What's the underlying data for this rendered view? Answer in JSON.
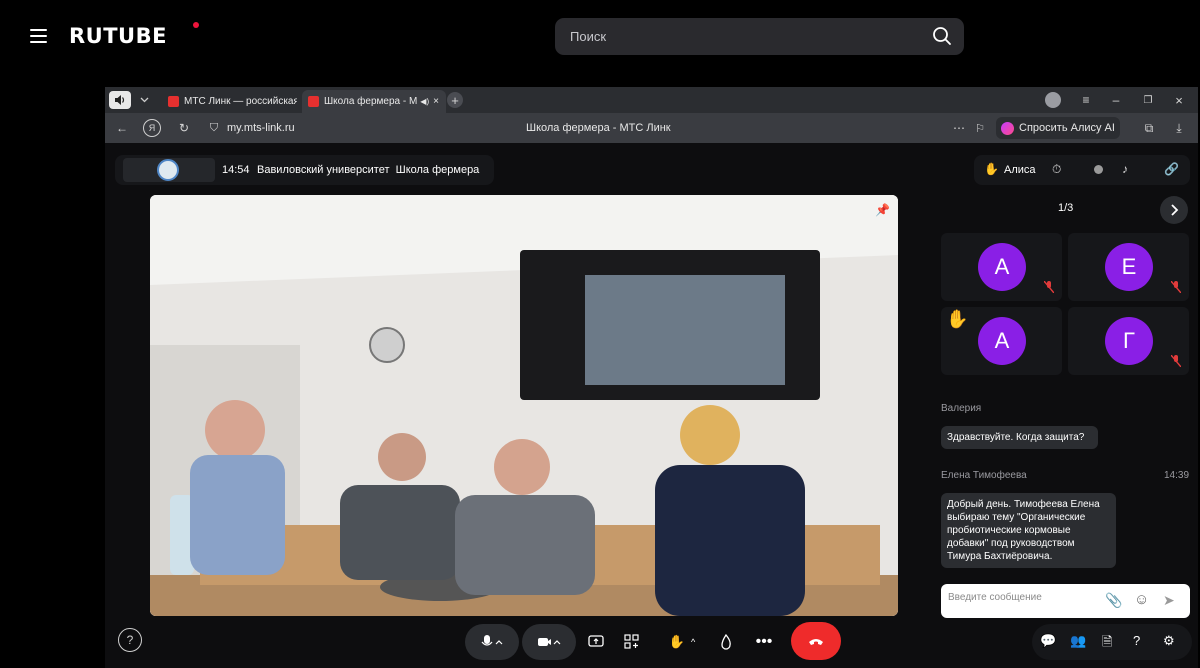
{
  "rutube": {
    "logo": "RUTUBE",
    "search_placeholder": "Поиск"
  },
  "browser": {
    "tabs": [
      {
        "label": "МТС Линк — российская"
      },
      {
        "label": "Школа фермера - М"
      }
    ],
    "address": "my.mts-link.ru",
    "page_title": "Школа фермера - МТС Линк",
    "alice_button": "Спросить Алису AI"
  },
  "meeting": {
    "time": "14:54",
    "title": "Вавиловский университет  Школа фермера",
    "alice_label": "Алиса",
    "page_indicator": "1/3",
    "participants": [
      {
        "initial": "А",
        "mic_muted": true,
        "hand_raised": false
      },
      {
        "initial": "Е",
        "mic_muted": true,
        "hand_raised": false
      },
      {
        "initial": "А",
        "mic_muted": false,
        "hand_raised": true
      },
      {
        "initial": "Г",
        "mic_muted": true,
        "hand_raised": false
      }
    ],
    "avatar_color": "#8a1fe6",
    "hangup_color": "#ef2b2b"
  },
  "chat": {
    "messages": [
      {
        "author": "Валерия",
        "time": "",
        "text": "Здравствуйте. Когда защита?"
      },
      {
        "author": "Елена Тимофеева",
        "time": "14:39",
        "lines": [
          "Добрый день. Тимофеева Елена",
          "выбираю тему \"Органические",
          "пробиотические кормовые",
          "добавки\" под руководством",
          "Тимура Бахтиёровича."
        ]
      }
    ],
    "input_placeholder": "Введите сообщение"
  },
  "controls": {
    "help": "?",
    "icons": [
      "mic-icon",
      "camera-icon",
      "screen-share-icon",
      "layout-icon",
      "raise-hand-icon",
      "reaction-icon",
      "more-icon",
      "hangup-icon",
      "chat-icon",
      "participants-icon",
      "files-icon",
      "questions-icon",
      "settings-icon"
    ]
  }
}
